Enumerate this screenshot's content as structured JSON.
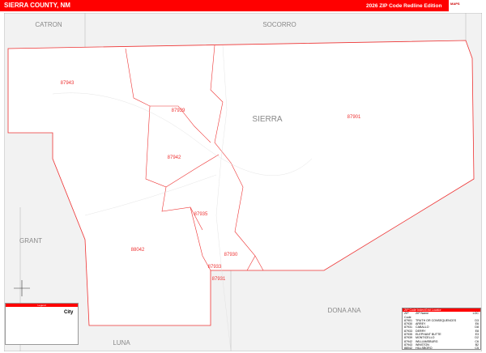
{
  "header": {
    "title": "SIERRA COUNTY, NM",
    "edition": "2026 ZIP Code Redline Edition"
  },
  "counties": {
    "main": "SIERRA",
    "neighbors": [
      "CATRON",
      "SOCORRO",
      "GRANT",
      "LUNA",
      "DONA ANA"
    ]
  },
  "zip_labels": [
    "87943",
    "87939",
    "87901",
    "87942",
    "87935",
    "87930",
    "88042",
    "87933",
    "87931"
  ],
  "zip_table": {
    "title": "ZIP Code Index/Grid Locator",
    "headers": [
      "ZIP Code",
      "ZIP Name",
      "LOC"
    ],
    "rows": [
      [
        "87901",
        "TRUTH OR CONSEQUENCES",
        "D3"
      ],
      [
        "87930",
        "ARREY",
        "E6"
      ],
      [
        "87931",
        "CABALLO",
        "D8"
      ],
      [
        "87933",
        "DERRY",
        "E8"
      ],
      [
        "87935",
        "ELEPHANT BUTTE",
        "E3"
      ],
      [
        "87939",
        "MONTICELLO",
        "D2"
      ],
      [
        "87942",
        "WILLIAMSBURG",
        "C6"
      ],
      [
        "87943",
        "WINSTON",
        "B2"
      ],
      [
        "88042",
        "HILLSBORO",
        "C5"
      ]
    ]
  },
  "legend": {
    "title": "Legend",
    "city_label": "City"
  },
  "colors": {
    "accent": "#ff0000"
  }
}
